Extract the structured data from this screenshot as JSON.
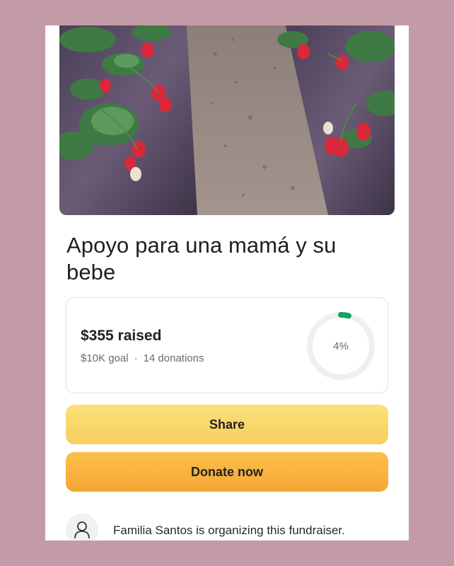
{
  "campaign": {
    "hero_image": "strawberry-field-photo",
    "title": "Apoyo para una mamá y su bebe"
  },
  "progress": {
    "raised_text": "$355 raised",
    "goal_text": "$10K goal",
    "separator": "·",
    "donations_text": "14 donations",
    "percent_text": "4%",
    "percent_value": 0.04,
    "ring_color": "#14a35f",
    "ring_track_color": "#efefef"
  },
  "actions": {
    "share_label": "Share",
    "donate_label": "Donate now"
  },
  "organizer": {
    "icon": "user-icon",
    "text": "Familia Santos is organizing this fundraiser."
  },
  "colors": {
    "background": "#c29ba6",
    "share_button": "#f9d86b",
    "donate_button": "#f9b13f"
  }
}
